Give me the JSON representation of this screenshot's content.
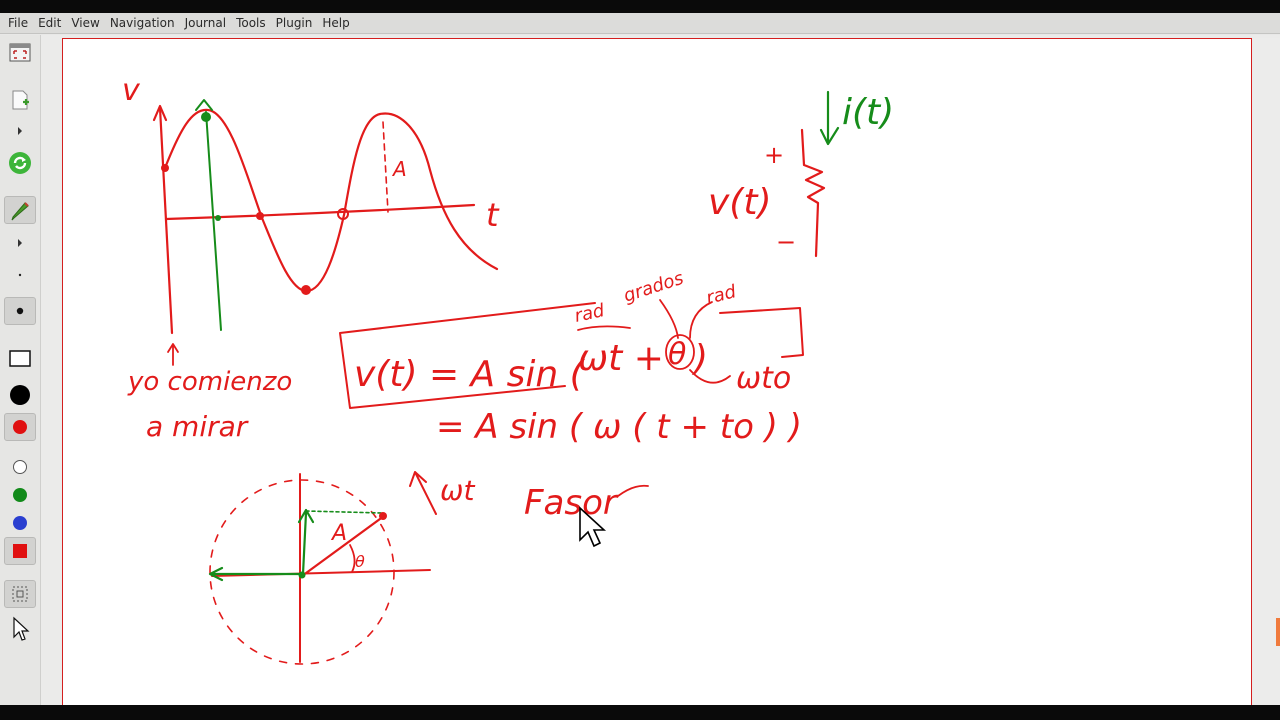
{
  "menu": {
    "items": [
      "File",
      "Edit",
      "View",
      "Navigation",
      "Journal",
      "Tools",
      "Plugin",
      "Help"
    ]
  },
  "toolbar": {
    "tools": [
      "fullscreen-icon",
      "new-page-icon",
      "expand-arrow-icon",
      "refresh-icon",
      "pen-icon",
      "expand-arrow-icon",
      "fine-dot-icon",
      "medium-dot-icon",
      "rectangle-icon",
      "black-color",
      "red-color",
      "white-color",
      "green-color",
      "blue-color",
      "red-fill-color",
      "select-icon",
      "pointer-icon"
    ],
    "colors": {
      "black": "#000000",
      "red": "#e01010",
      "white": "#ffffff",
      "green": "#128a1a",
      "blue": "#2a3fd0"
    }
  },
  "ink": {
    "red": "#e21b1b",
    "green": "#168c1a"
  },
  "notes": {
    "axis_v": "v",
    "axis_t": "t",
    "amplitude": "A",
    "current": "i(t)",
    "plus": "+",
    "minus": "−",
    "voltage": "v(t)",
    "yo_comienzo": "yo comienzo",
    "a_mirar": "a mirar",
    "rad_left": "rad",
    "grados": "grados",
    "rad_right": "rad",
    "eq_lhs": "v(t) = A sin (",
    "eq_wt": "ωt +",
    "eq_theta": "θ",
    "eq_close": ")",
    "eq_wto": "ωto",
    "eq_line2": "= A sin ( ω ( t + to ) )",
    "omega_t": "ωt",
    "fasor": "Fasor",
    "phasor_A": "A",
    "phasor_theta": "θ"
  }
}
